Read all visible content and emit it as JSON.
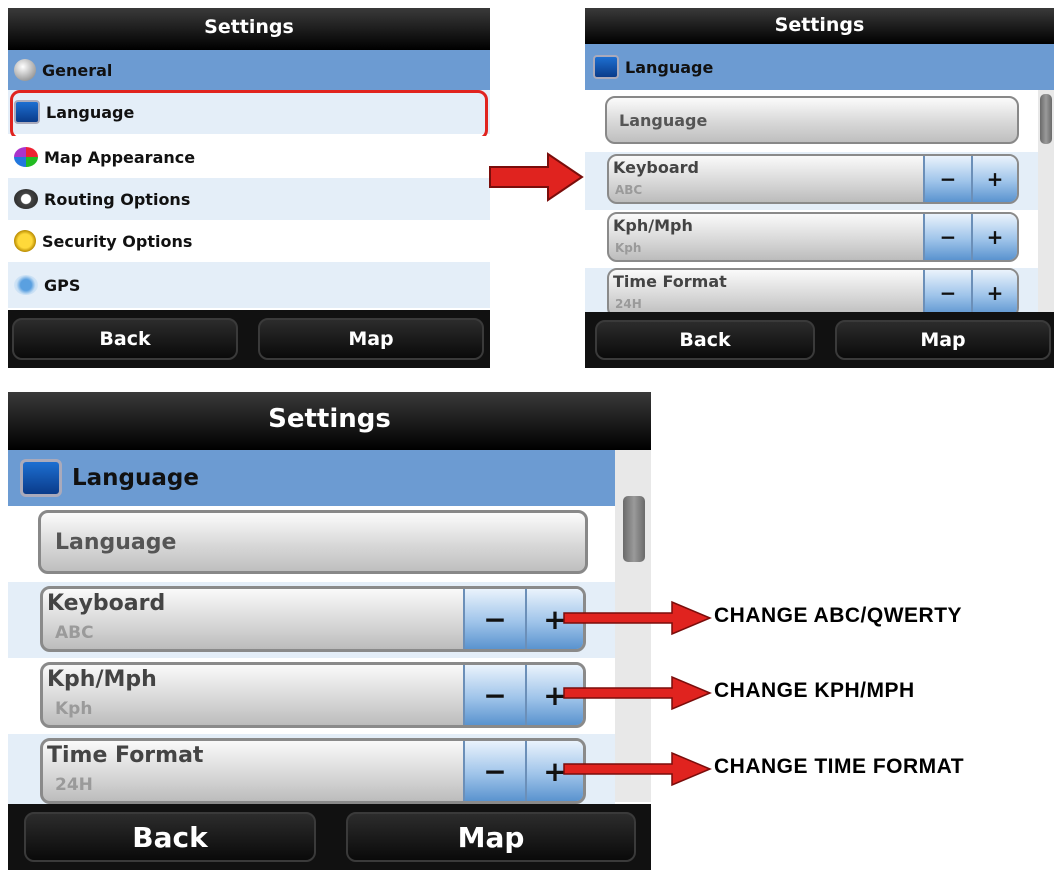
{
  "screen1": {
    "title": "Settings",
    "items": [
      {
        "label": "General",
        "icon": "general-icon"
      },
      {
        "label": "Language",
        "icon": "language-icon"
      },
      {
        "label": "Map Appearance",
        "icon": "map-appearance-icon"
      },
      {
        "label": "Routing Options",
        "icon": "routing-options-icon"
      },
      {
        "label": "Security Options",
        "icon": "security-options-icon"
      },
      {
        "label": "GPS",
        "icon": "gps-icon"
      }
    ],
    "back_label": "Back",
    "map_label": "Map"
  },
  "screen2": {
    "title": "Settings",
    "section": "Language",
    "language_button": "Language",
    "rows": [
      {
        "label": "Keyboard",
        "value": "ABC"
      },
      {
        "label": "Kph/Mph",
        "value": "Kph"
      },
      {
        "label": "Time Format",
        "value": "24H"
      }
    ],
    "back_label": "Back",
    "map_label": "Map"
  },
  "screen3": {
    "title": "Settings",
    "section": "Language",
    "language_button": "Language",
    "rows": [
      {
        "label": "Keyboard",
        "value": "ABC"
      },
      {
        "label": "Kph/Mph",
        "value": "Kph"
      },
      {
        "label": "Time Format",
        "value": "24H"
      }
    ],
    "back_label": "Back",
    "map_label": "Map"
  },
  "stepper": {
    "minus": "−",
    "plus": "+"
  },
  "annotations": [
    "CHANGE ABC/QWERTY",
    "CHANGE KPH/MPH",
    "CHANGE TIME FORMAT"
  ],
  "colors": {
    "highlight": "#e0231f",
    "selected_row": "#6c9bd2",
    "arrow": "#e0231f"
  }
}
